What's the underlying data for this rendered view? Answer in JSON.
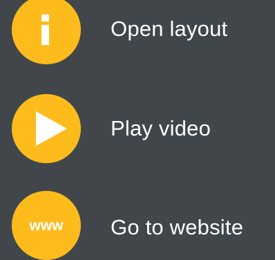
{
  "theme": {
    "background": "#41464b",
    "accent": "#fdbc1c",
    "text": "#ffffff"
  },
  "menu": {
    "items": [
      {
        "label": "Open layout",
        "icon": "info-icon"
      },
      {
        "label": "Play video",
        "icon": "play-icon"
      },
      {
        "label": "Go to website",
        "icon": "www-icon",
        "icon_text": "www"
      }
    ]
  }
}
